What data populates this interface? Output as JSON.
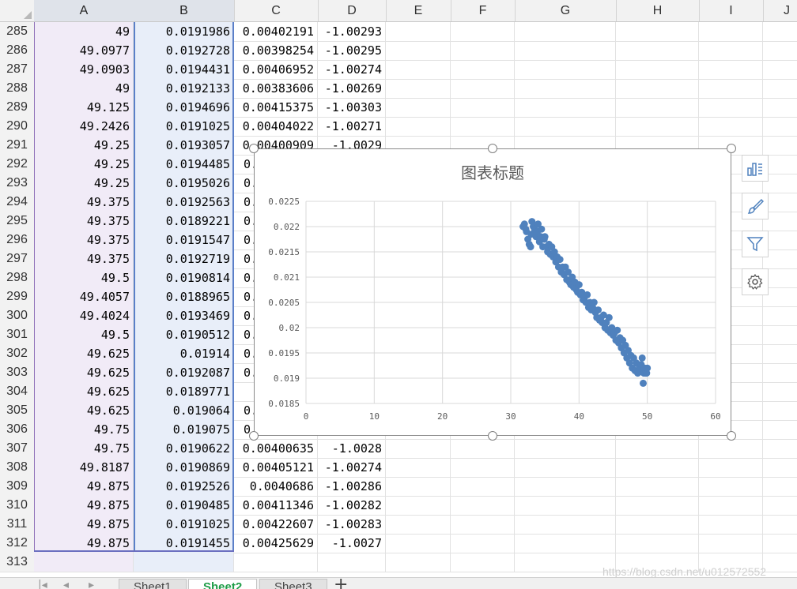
{
  "columns": [
    "A",
    "B",
    "C",
    "D",
    "E",
    "F",
    "G",
    "H",
    "I",
    "J"
  ],
  "rows": [
    {
      "n": "285",
      "a": "49",
      "b": "0.0191986",
      "c": "0.00402191",
      "d": "-1.00293"
    },
    {
      "n": "286",
      "a": "49.0977",
      "b": "0.0192728",
      "c": "0.00398254",
      "d": "-1.00295"
    },
    {
      "n": "287",
      "a": "49.0903",
      "b": "0.0194431",
      "c": "0.00406952",
      "d": "-1.00274"
    },
    {
      "n": "288",
      "a": "49",
      "b": "0.0192133",
      "c": "0.00383606",
      "d": "-1.00269"
    },
    {
      "n": "289",
      "a": "49.125",
      "b": "0.0194696",
      "c": "0.00415375",
      "d": "-1.00303"
    },
    {
      "n": "290",
      "a": "49.2426",
      "b": "0.0191025",
      "c": "0.00404022",
      "d": "-1.00271"
    },
    {
      "n": "291",
      "a": "49.25",
      "b": "0.0193057",
      "c": "0.00400909",
      "d": "-1.0029"
    },
    {
      "n": "292",
      "a": "49.25",
      "b": "0.0194485",
      "c": "0.",
      "d": ""
    },
    {
      "n": "293",
      "a": "49.25",
      "b": "0.0195026",
      "c": "0.",
      "d": ""
    },
    {
      "n": "294",
      "a": "49.375",
      "b": "0.0192563",
      "c": "0.",
      "d": ""
    },
    {
      "n": "295",
      "a": "49.375",
      "b": "0.0189221",
      "c": "0.",
      "d": ""
    },
    {
      "n": "296",
      "a": "49.375",
      "b": "0.0191547",
      "c": "0.",
      "d": ""
    },
    {
      "n": "297",
      "a": "49.375",
      "b": "0.0192719",
      "c": "0.",
      "d": ""
    },
    {
      "n": "298",
      "a": "49.5",
      "b": "0.0190814",
      "c": "0.",
      "d": ""
    },
    {
      "n": "299",
      "a": "49.4057",
      "b": "0.0188965",
      "c": "0.",
      "d": ""
    },
    {
      "n": "300",
      "a": "49.4024",
      "b": "0.0193469",
      "c": "0.",
      "d": ""
    },
    {
      "n": "301",
      "a": "49.5",
      "b": "0.0190512",
      "c": "0.",
      "d": ""
    },
    {
      "n": "302",
      "a": "49.625",
      "b": "0.01914",
      "c": "0.",
      "d": ""
    },
    {
      "n": "303",
      "a": "49.625",
      "b": "0.0192087",
      "c": "0.",
      "d": ""
    },
    {
      "n": "304",
      "a": "49.625",
      "b": "0.0189771",
      "c": "",
      "d": ""
    },
    {
      "n": "305",
      "a": "49.625",
      "b": "0.019064",
      "c": "0.",
      "d": ""
    },
    {
      "n": "306",
      "a": "49.75",
      "b": "0.019075",
      "c": "0",
      "d": ""
    },
    {
      "n": "307",
      "a": "49.75",
      "b": "0.0190622",
      "c": "0.00400635",
      "d": "-1.0028"
    },
    {
      "n": "308",
      "a": "49.8187",
      "b": "0.0190869",
      "c": "0.00405121",
      "d": "-1.00274"
    },
    {
      "n": "309",
      "a": "49.875",
      "b": "0.0192526",
      "c": "0.0040686",
      "d": "-1.00286"
    },
    {
      "n": "310",
      "a": "49.875",
      "b": "0.0190485",
      "c": "0.00411346",
      "d": "-1.00282"
    },
    {
      "n": "311",
      "a": "49.875",
      "b": "0.0191025",
      "c": "0.00422607",
      "d": "-1.00283"
    },
    {
      "n": "312",
      "a": "49.875",
      "b": "0.0191455",
      "c": "0.00425629",
      "d": "-1.0027"
    },
    {
      "n": "313",
      "a": "",
      "b": "",
      "c": "",
      "d": ""
    }
  ],
  "chart": {
    "title": "图表标题",
    "marker_color": "#4f81bd"
  },
  "chart_data": {
    "type": "scatter",
    "title": "图表标题",
    "xlabel": "",
    "ylabel": "",
    "xlim": [
      0,
      60
    ],
    "ylim": [
      0.0185,
      0.0225
    ],
    "x_ticks": [
      "0",
      "10",
      "20",
      "30",
      "40",
      "50",
      "60"
    ],
    "y_ticks": [
      "0.0185",
      "0.019",
      "0.0195",
      "0.02",
      "0.0205",
      "0.021",
      "0.0215",
      "0.022",
      "0.0225"
    ],
    "grid": true,
    "legend": "none",
    "series": [
      {
        "points": [
          [
            31.8,
            0.022
          ],
          [
            32.0,
            0.02205
          ],
          [
            32.2,
            0.02195
          ],
          [
            32.3,
            0.0219
          ],
          [
            32.5,
            0.02175
          ],
          [
            32.7,
            0.02165
          ],
          [
            32.9,
            0.0216
          ],
          [
            33.0,
            0.02185
          ],
          [
            33.1,
            0.0221
          ],
          [
            33.3,
            0.022
          ],
          [
            33.5,
            0.02195
          ],
          [
            33.7,
            0.0218
          ],
          [
            33.9,
            0.0219
          ],
          [
            34.0,
            0.02205
          ],
          [
            34.2,
            0.0217
          ],
          [
            34.4,
            0.0218
          ],
          [
            34.5,
            0.02195
          ],
          [
            34.7,
            0.0216
          ],
          [
            34.9,
            0.02175
          ],
          [
            35.0,
            0.0218
          ],
          [
            35.2,
            0.0216
          ],
          [
            35.4,
            0.0215
          ],
          [
            35.6,
            0.02165
          ],
          [
            35.8,
            0.02145
          ],
          [
            36.0,
            0.0216
          ],
          [
            36.2,
            0.0214
          ],
          [
            36.4,
            0.0215
          ],
          [
            36.6,
            0.0213
          ],
          [
            36.8,
            0.0214
          ],
          [
            37.0,
            0.0212
          ],
          [
            37.2,
            0.02135
          ],
          [
            37.4,
            0.0211
          ],
          [
            37.6,
            0.0212
          ],
          [
            37.8,
            0.02105
          ],
          [
            38.0,
            0.0212
          ],
          [
            38.2,
            0.02095
          ],
          [
            38.4,
            0.0211
          ],
          [
            38.6,
            0.0209
          ],
          [
            38.8,
            0.02085
          ],
          [
            39.0,
            0.021
          ],
          [
            39.2,
            0.0208
          ],
          [
            39.4,
            0.0209
          ],
          [
            39.6,
            0.02075
          ],
          [
            39.8,
            0.0207
          ],
          [
            40.0,
            0.02085
          ],
          [
            40.2,
            0.02065
          ],
          [
            40.4,
            0.0207
          ],
          [
            40.6,
            0.02055
          ],
          [
            40.8,
            0.0206
          ],
          [
            41.0,
            0.0205
          ],
          [
            41.2,
            0.02065
          ],
          [
            41.4,
            0.0204
          ],
          [
            41.6,
            0.0205
          ],
          [
            41.8,
            0.02035
          ],
          [
            42.0,
            0.0204
          ],
          [
            42.2,
            0.0205
          ],
          [
            42.4,
            0.0203
          ],
          [
            42.6,
            0.0202
          ],
          [
            42.8,
            0.02035
          ],
          [
            43.0,
            0.02015
          ],
          [
            43.2,
            0.0202
          ],
          [
            43.4,
            0.0201
          ],
          [
            43.6,
            0.02025
          ],
          [
            43.8,
            0.02
          ],
          [
            44.0,
            0.0201
          ],
          [
            44.2,
            0.01995
          ],
          [
            44.4,
            0.0202
          ],
          [
            44.6,
            0.0199
          ],
          [
            44.8,
            0.02
          ],
          [
            45.0,
            0.01985
          ],
          [
            45.2,
            0.0199
          ],
          [
            45.4,
            0.01975
          ],
          [
            45.6,
            0.01995
          ],
          [
            45.8,
            0.0197
          ],
          [
            46.0,
            0.0198
          ],
          [
            46.2,
            0.0196
          ],
          [
            46.4,
            0.01975
          ],
          [
            46.6,
            0.0195
          ],
          [
            46.8,
            0.01965
          ],
          [
            47.0,
            0.0194
          ],
          [
            47.2,
            0.01955
          ],
          [
            47.4,
            0.0193
          ],
          [
            47.6,
            0.01945
          ],
          [
            47.8,
            0.0192
          ],
          [
            48.0,
            0.0194
          ],
          [
            48.2,
            0.01915
          ],
          [
            48.4,
            0.0193
          ],
          [
            48.6,
            0.0191
          ],
          [
            48.8,
            0.01925
          ],
          [
            49.0,
            0.0192
          ],
          [
            49.1,
            0.01927
          ],
          [
            49.25,
            0.0194
          ],
          [
            49.4,
            0.0189
          ],
          [
            49.5,
            0.0191
          ],
          [
            49.6,
            0.0192
          ],
          [
            49.75,
            0.0191
          ],
          [
            49.9,
            0.0191
          ],
          [
            50.0,
            0.0192
          ]
        ]
      }
    ]
  },
  "sheets": [
    "Sheet1",
    "Sheet2",
    "Sheet3"
  ],
  "active_sheet": "Sheet2",
  "watermark": "https://blog.csdn.net/u012572552"
}
